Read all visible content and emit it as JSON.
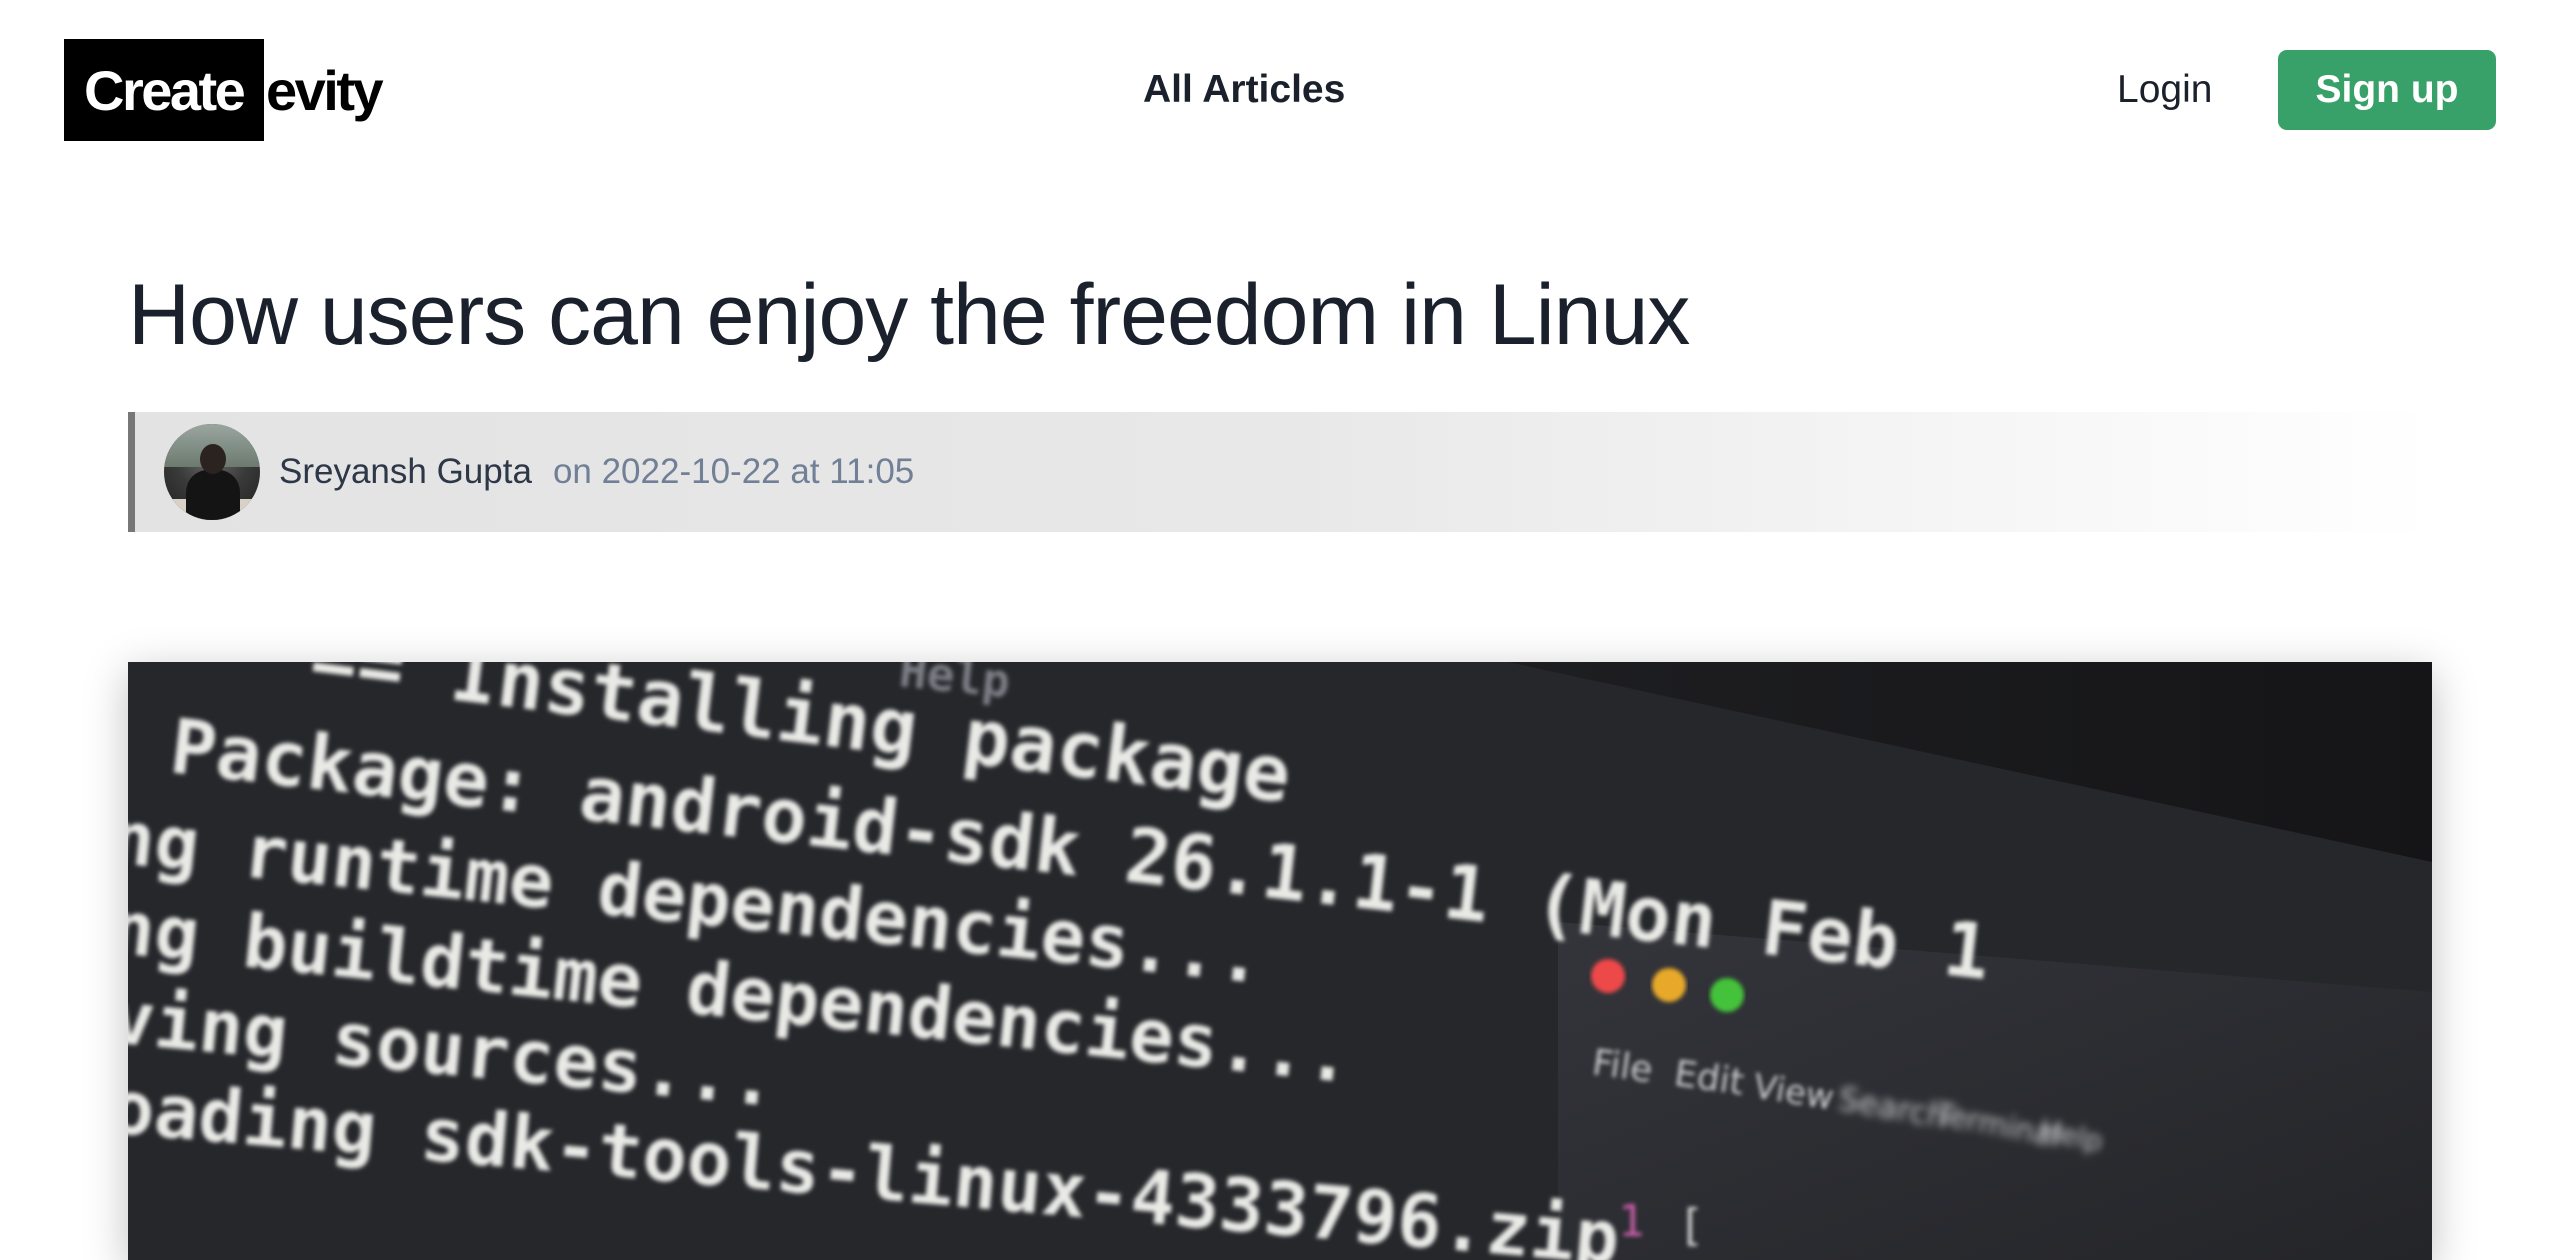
{
  "header": {
    "logo_part1": "Create",
    "logo_part2": "evity",
    "nav_all_articles": "All Articles",
    "login_label": "Login",
    "signup_label": "Sign up"
  },
  "article": {
    "title": "How users can enjoy the freedom in Linux",
    "author": "Sreyansh Gupta",
    "date": "on 2022-10-22 at 11:05"
  },
  "hero_image": {
    "terminal_lines": [
      "Help",
      "== Installing package",
      "Package: android-sdk 26.1.1-1 (Mon Feb 1",
      "ng runtime dependencies...",
      "ng buildtime dependencies...",
      "ving sources...",
      "oading sdk-tools-linux-4333796.zip"
    ],
    "window_menu": [
      "File",
      "Edit",
      "View",
      "Search",
      "Terminal",
      "Help"
    ],
    "editor_line_number": "1",
    "editor_line_text": "["
  },
  "colors": {
    "accent": "#38a169",
    "text": "#1a202c",
    "muted": "#718096",
    "byline_border": "#777777"
  }
}
